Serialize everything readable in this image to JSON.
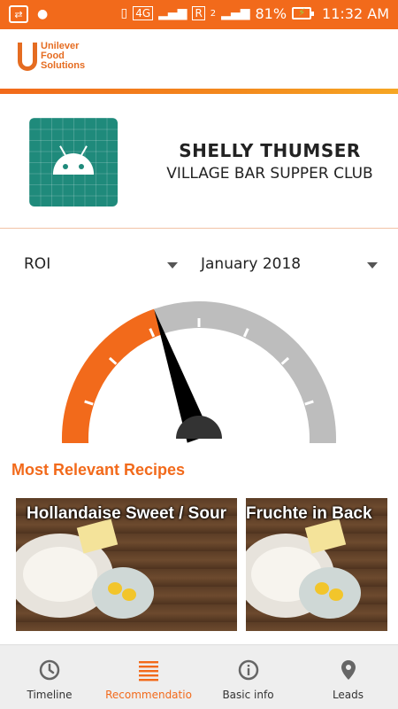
{
  "status_bar": {
    "network": "4G",
    "roaming": "R",
    "sim": "2",
    "battery": "81%",
    "time": "11:32 AM"
  },
  "header": {
    "logo_lines": [
      "Unilever",
      "Food",
      "Solutions"
    ]
  },
  "profile": {
    "name": "SHELLY THUMSER",
    "company": "VILLAGE BAR SUPPER CLUB"
  },
  "filters": {
    "metric": "ROI",
    "period": "January 2018"
  },
  "gauge": {
    "value": 0.42,
    "colors": {
      "filled": "#f26a1b",
      "empty": "#bdbdbd",
      "needle": "#000000",
      "hub": "#333333"
    }
  },
  "recipes": {
    "section_title": "Most Relevant Recipes",
    "items": [
      {
        "title": "Hollandaise Sweet / Sour"
      },
      {
        "title": "Fruchte in Back"
      }
    ]
  },
  "nav": {
    "items": [
      {
        "label": "Timeline",
        "icon": "clock-icon"
      },
      {
        "label": "Recommendatio",
        "icon": "list-icon"
      },
      {
        "label": "Basic info",
        "icon": "info-icon"
      },
      {
        "label": "Leads",
        "icon": "location-pin-icon"
      }
    ],
    "active_index": 1,
    "accent": "#f26a1b"
  },
  "colors": {
    "brand": "#f26a1b",
    "app_icon": "#1f8a7b"
  }
}
